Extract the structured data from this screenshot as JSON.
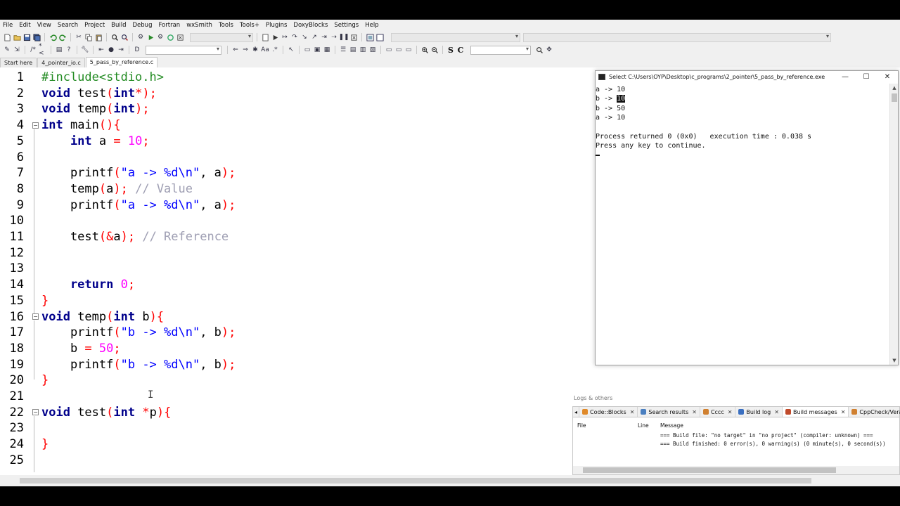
{
  "menu": [
    "File",
    "Edit",
    "View",
    "Search",
    "Project",
    "Build",
    "Debug",
    "Fortran",
    "wxSmith",
    "Tools",
    "Tools+",
    "Plugins",
    "DoxyBlocks",
    "Settings",
    "Help"
  ],
  "tabs": [
    {
      "label": "Start here",
      "active": false
    },
    {
      "label": "4_pointer_io.c",
      "active": false
    },
    {
      "label": "5_pass_by_reference.c",
      "active": true
    }
  ],
  "editor": {
    "line_numbers": [
      "1",
      "2",
      "3",
      "4",
      "5",
      "6",
      "7",
      "8",
      "9",
      "10",
      "11",
      "12",
      "13",
      "14",
      "15",
      "16",
      "17",
      "18",
      "19",
      "20",
      "21",
      "22",
      "23",
      "24",
      "25"
    ],
    "code": {
      "l1": "#include<stdio.h>",
      "l2a": "void",
      "l2b": " test",
      "l2c": "(",
      "l2d": "int",
      "l2e": "*);",
      "l3a": "void",
      "l3b": " temp",
      "l3c": "(",
      "l3d": "int",
      "l3e": ");",
      "l4a": "int",
      "l4b": " main",
      "l4c": "(){",
      "l5a": "    int",
      "l5b": " a ",
      "l5c": "=",
      "l5d": " ",
      "l5e": "10",
      "l5f": ";",
      "l7a": "    printf",
      "l7b": "(",
      "l7c": "\"a -> %d\\n\"",
      "l7d": ", a",
      "l7e": ");",
      "l8a": "    temp",
      "l8b": "(",
      "l8c": "a",
      "l8d": ");",
      "l8e": " // Value",
      "l9a": "    printf",
      "l9b": "(",
      "l9c": "\"a -> %d\\n\"",
      "l9d": ", a",
      "l9e": ");",
      "l11a": "    test",
      "l11b": "(&",
      "l11c": "a",
      "l11d": ");",
      "l11e": " // Reference",
      "l14a": "    return",
      "l14b": " ",
      "l14c": "0",
      "l14d": ";",
      "l15": "}",
      "l16a": "void",
      "l16b": " temp",
      "l16c": "(",
      "l16d": "int",
      "l16e": " b",
      "l16f": "){",
      "l17a": "    printf",
      "l17b": "(",
      "l17c": "\"b -> %d\\n\"",
      "l17d": ", b",
      "l17e": ");",
      "l18a": "    b ",
      "l18b": "=",
      "l18c": " ",
      "l18d": "50",
      "l18e": ";",
      "l19a": "    printf",
      "l19b": "(",
      "l19c": "\"b -> %d\\n\"",
      "l19d": ", b",
      "l19e": ");",
      "l20": "}",
      "l22a": "void",
      "l22b": " test",
      "l22c": "(",
      "l22d": "int",
      "l22e": " ",
      "l22f": "*",
      "l22g": "p",
      "l22h": "){",
      "l24": "}"
    }
  },
  "console": {
    "title": "Select C:\\Users\\OYP\\Desktop\\c_programs\\2_pointer\\5_pass_by_reference.exe",
    "line1": "a -> 10",
    "line2_prefix": "b -> ",
    "line2_selected": "10",
    "line3": "b -> 50",
    "line4": "a -> 10",
    "line5": "Process returned 0 (0x0)   execution time : 0.038 s",
    "line6": "Press any key to continue."
  },
  "logs": {
    "title": "Logs & others",
    "tabs": [
      "Code::Blocks",
      "Search results",
      "Cccc",
      "Build log",
      "Build messages",
      "CppCheck/Vera++"
    ],
    "active_tab": "Build messages",
    "columns": {
      "file": "File",
      "line": "Line",
      "message": "Message"
    },
    "rows": [
      "=== Build file: \"no target\" in \"no project\" (compiler: unknown) ===",
      "=== Build finished: 0 error(s), 0 warning(s) (0 minute(s), 0 second(s))"
    ]
  },
  "colors": {
    "keyword": "#00008b",
    "string": "#0000ff",
    "number": "#ff00ff",
    "operator": "#ff0000",
    "comment": "#a0a0b4",
    "preprocessor": "#228b22"
  }
}
